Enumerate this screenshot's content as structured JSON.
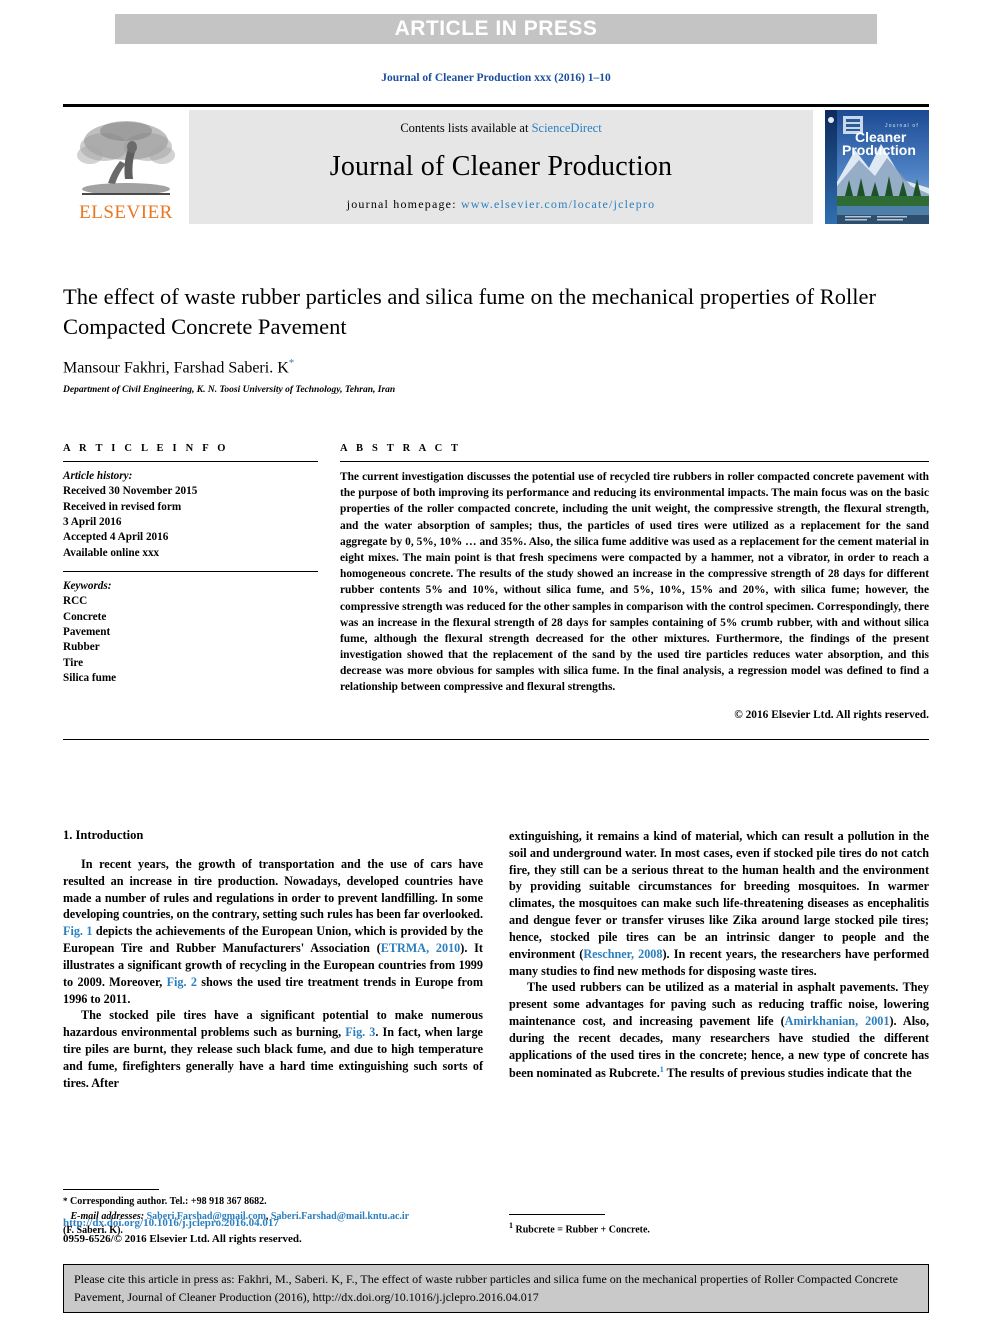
{
  "banner": {
    "label": "ARTICLE IN PRESS"
  },
  "running_head": {
    "text": "Journal of Cleaner Production xxx (2016) 1–10"
  },
  "masthead": {
    "publisher_name": "ELSEVIER",
    "contents_prefix": "Contents lists available at ",
    "contents_link": "ScienceDirect",
    "journal_title": "Journal of Cleaner Production",
    "homepage_prefix": "journal homepage: ",
    "homepage_url": "www.elsevier.com/locate/jclepro",
    "cover_line1": "Journal of",
    "cover_line2": "Cleaner",
    "cover_line3": "Production"
  },
  "article": {
    "title": "The effect of waste rubber particles and silica fume on the mechanical properties of Roller Compacted Concrete Pavement",
    "authors": "Mansour Fakhri, Farshad Saberi. K",
    "corresponding_marker": "*",
    "affiliation": "Department of Civil Engineering, K. N. Toosi University of Technology, Tehran, Iran"
  },
  "article_info": {
    "heading": "A R T I C L E   I N F O",
    "history_label": "Article history:",
    "history": [
      "Received 30 November 2015",
      "Received in revised form",
      "3 April 2016",
      "Accepted 4 April 2016",
      "Available online xxx"
    ],
    "keywords_label": "Keywords:",
    "keywords": [
      "RCC",
      "Concrete",
      "Pavement",
      "Rubber",
      "Tire",
      "Silica fume"
    ]
  },
  "abstract": {
    "heading": "A B S T R A C T",
    "text": "The current investigation discusses the potential use of recycled tire rubbers in roller compacted concrete pavement with the purpose of both improving its performance and reducing its environmental impacts. The main focus was on the basic properties of the roller compacted concrete, including the unit weight, the compressive strength, the flexural strength, and the water absorption of samples; thus, the particles of used tires were utilized as a replacement for the sand aggregate by 0, 5%, 10% … and 35%. Also, the silica fume additive was used as a replacement for the cement material in eight mixes. The main point is that fresh specimens were compacted by a hammer, not a vibrator, in order to reach a homogeneous concrete. The results of the study showed an increase in the compressive strength of 28 days for different rubber contents 5% and 10%, without silica fume, and 5%, 10%, 15% and 20%, with silica fume; however, the compressive strength was reduced for the other samples in comparison with the control specimen. Correspondingly, there was an increase in the flexural strength of 28 days for samples containing of 5% crumb rubber, with and without silica fume, although the flexural strength decreased for the other mixtures. Furthermore, the findings of the present investigation showed that the replacement of the sand by the used tire particles reduces water absorption, and this decrease was more obvious for samples with silica fume. In the final analysis, a regression model was defined to find a relationship between compressive and flexural strengths.",
    "copyright": "© 2016 Elsevier Ltd. All rights reserved."
  },
  "body": {
    "section_number_title": "1.  Introduction",
    "left_paragraphs": [
      {
        "segments": [
          {
            "t": "In recent years, the growth of transportation and the use of cars have resulted an increase in tire production. Nowadays, developed countries have made a number of rules and regulations in order to prevent landfilling. In some developing countries, on the contrary, setting such rules has been far overlooked. ",
            "k": "plain"
          },
          {
            "t": "Fig. 1",
            "k": "link"
          },
          {
            "t": " depicts the achievements of the European Union, which is provided by the European Tire and Rubber Manufacturers' Association (",
            "k": "plain"
          },
          {
            "t": "ETRMA, 2010",
            "k": "link"
          },
          {
            "t": "). It illustrates a significant growth of recycling in the European countries from 1999 to 2009. Moreover, ",
            "k": "plain"
          },
          {
            "t": "Fig. 2",
            "k": "link"
          },
          {
            "t": " shows the used tire treatment trends in Europe from 1996 to 2011.",
            "k": "plain"
          }
        ]
      },
      {
        "segments": [
          {
            "t": "The stocked pile tires have a significant potential to make numerous hazardous environmental problems such as burning, ",
            "k": "plain"
          },
          {
            "t": "Fig. 3",
            "k": "link"
          },
          {
            "t": ". In fact, when large tire piles are burnt, they release such black fume, and due to high temperature and fume, firefighters generally have a hard time extinguishing such sorts of tires. After",
            "k": "plain"
          }
        ]
      }
    ],
    "right_paragraphs": [
      {
        "segments": [
          {
            "t": "extinguishing, it remains a kind of material, which can result a pollution in the soil and underground water. In most cases, even if stocked pile tires do not catch fire, they still can be a serious threat to the human health and the environment by providing suitable circumstances for breeding mosquitoes. In warmer climates, the mosquitoes can make such life-threatening diseases as encephalitis and dengue fever or transfer viruses like Zika around large stocked pile tires; hence, stocked pile tires can be an intrinsic danger to people and the environment (",
            "k": "plain"
          },
          {
            "t": "Reschner, 2008",
            "k": "link"
          },
          {
            "t": "). In recent years, the researchers have performed many studies to find new methods for disposing waste tires.",
            "k": "plain"
          }
        ],
        "no_indent": true
      },
      {
        "segments": [
          {
            "t": "The used rubbers can be utilized as a material in asphalt pavements. They present some advantages for paving such as reducing traffic noise, lowering maintenance cost, and increasing pavement life (",
            "k": "plain"
          },
          {
            "t": "Amirkhanian, 2001",
            "k": "link"
          },
          {
            "t": "). Also, during the recent decades, many researchers have studied the different applications of the used tires in the concrete; hence, a new type of concrete has been nominated as Rubcrete.",
            "k": "plain"
          },
          {
            "t": "1",
            "k": "sup"
          },
          {
            "t": " The results of previous studies indicate that the",
            "k": "plain"
          }
        ]
      }
    ]
  },
  "footnotes": {
    "left": {
      "star": "*",
      "corresponding": " Corresponding author. Tel.: +98 918 367 8682.",
      "email_label": "E-mail addresses:",
      "email1": "Saberi.Farshad@gmail.com",
      "email_sep": ", ",
      "email2": "Saberi.Farshad@mail.kntu.ac.ir",
      "attribution": "(F. Saberi. K)."
    },
    "right": {
      "marker": "1",
      "text": " Rubcrete = Rubber + Concrete."
    }
  },
  "doi_footer": {
    "doi_url": "http://dx.doi.org/10.1016/j.jclepro.2016.04.017",
    "issn_line": "0959-6526/© 2016 Elsevier Ltd. All rights reserved."
  },
  "citation_box": {
    "text": "Please cite this article in press as: Fakhri, M., Saberi. K, F., The effect of waste rubber particles and silica fume on the mechanical properties of Roller Compacted Concrete Pavement, Journal of Cleaner Production (2016), http://dx.doi.org/10.1016/j.jclepro.2016.04.017"
  },
  "colors": {
    "banner_bg": "#c4c4c4",
    "link_blue": "#2b7fbf",
    "running_head_blue": "#1b4f9c",
    "elsevier_orange": "#E87722",
    "masthead_bg": "#e6e6e6",
    "cite_box_bg": "#c9c9c9"
  }
}
